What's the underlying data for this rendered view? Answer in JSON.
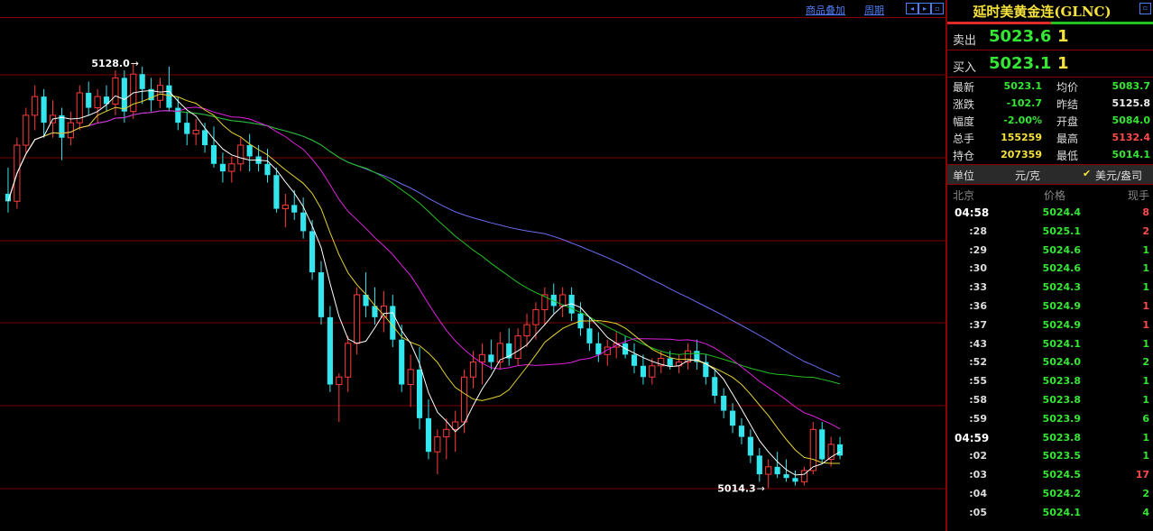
{
  "toolbar": {
    "overlay_label": "商品叠加",
    "period_label": "周期",
    "buttons": [
      "◂",
      "▸",
      "▫"
    ]
  },
  "chart_data": {
    "type": "candlestick",
    "y_range": [
      5005,
      5140
    ],
    "max_label": "5128.0",
    "min_label": "5014.3",
    "colors": {
      "up": "#ff3b3b",
      "down": "#33e6ee",
      "gridline": "#7a0000",
      "ma5": "#ffffff",
      "ma10": "#e6d230",
      "ma20": "#e020e0",
      "ma40": "#22c022",
      "ma60": "#6c6cf0"
    },
    "candles": [
      [
        5093,
        5100,
        5088,
        5091
      ],
      [
        5091,
        5108,
        5089,
        5106
      ],
      [
        5106,
        5116,
        5104,
        5114
      ],
      [
        5114,
        5122,
        5110,
        5119
      ],
      [
        5119,
        5121,
        5108,
        5112
      ],
      [
        5112,
        5118,
        5108,
        5114
      ],
      [
        5114,
        5116,
        5102,
        5108
      ],
      [
        5108,
        5115,
        5106,
        5112
      ],
      [
        5112,
        5122,
        5110,
        5120
      ],
      [
        5120,
        5123,
        5114,
        5116
      ],
      [
        5116,
        5121,
        5112,
        5119
      ],
      [
        5119,
        5122,
        5115,
        5117
      ],
      [
        5117,
        5126,
        5114,
        5124
      ],
      [
        5124,
        5126,
        5112,
        5115
      ],
      [
        5115,
        5128,
        5113,
        5125
      ],
      [
        5125,
        5127,
        5117,
        5121
      ],
      [
        5121,
        5124,
        5115,
        5118
      ],
      [
        5118,
        5124,
        5116,
        5122
      ],
      [
        5122,
        5127,
        5115,
        5116
      ],
      [
        5116,
        5119,
        5110,
        5112
      ],
      [
        5112,
        5115,
        5106,
        5109
      ],
      [
        5109,
        5113,
        5106,
        5110
      ],
      [
        5110,
        5112,
        5104,
        5106
      ],
      [
        5106,
        5111,
        5100,
        5101
      ],
      [
        5101,
        5104,
        5096,
        5099
      ],
      [
        5099,
        5103,
        5096,
        5101
      ],
      [
        5101,
        5108,
        5099,
        5106
      ],
      [
        5106,
        5109,
        5099,
        5103
      ],
      [
        5103,
        5106,
        5099,
        5101
      ],
      [
        5101,
        5105,
        5096,
        5098
      ],
      [
        5098,
        5100,
        5088,
        5089
      ],
      [
        5089,
        5093,
        5084,
        5090
      ],
      [
        5090,
        5094,
        5086,
        5088
      ],
      [
        5088,
        5092,
        5081,
        5083
      ],
      [
        5083,
        5086,
        5070,
        5072
      ],
      [
        5072,
        5075,
        5058,
        5060
      ],
      [
        5060,
        5063,
        5040,
        5042
      ],
      [
        5042,
        5045,
        5032,
        5044
      ],
      [
        5044,
        5055,
        5040,
        5053
      ],
      [
        5053,
        5068,
        5050,
        5066
      ],
      [
        5066,
        5072,
        5060,
        5063
      ],
      [
        5063,
        5068,
        5058,
        5060
      ],
      [
        5060,
        5067,
        5056,
        5063
      ],
      [
        5063,
        5066,
        5052,
        5054
      ],
      [
        5054,
        5058,
        5040,
        5042
      ],
      [
        5042,
        5050,
        5036,
        5046
      ],
      [
        5046,
        5052,
        5030,
        5033
      ],
      [
        5033,
        5038,
        5022,
        5024
      ],
      [
        5024,
        5030,
        5018,
        5028
      ],
      [
        5028,
        5033,
        5022,
        5030
      ],
      [
        5030,
        5035,
        5024,
        5032
      ],
      [
        5032,
        5046,
        5029,
        5044
      ],
      [
        5044,
        5051,
        5041,
        5048
      ],
      [
        5048,
        5053,
        5042,
        5050
      ],
      [
        5050,
        5054,
        5046,
        5048
      ],
      [
        5048,
        5056,
        5046,
        5053
      ],
      [
        5053,
        5057,
        5047,
        5049
      ],
      [
        5049,
        5057,
        5047,
        5055
      ],
      [
        5055,
        5061,
        5052,
        5058
      ],
      [
        5058,
        5064,
        5054,
        5062
      ],
      [
        5062,
        5068,
        5058,
        5066
      ],
      [
        5066,
        5069,
        5061,
        5063
      ],
      [
        5063,
        5068,
        5060,
        5066
      ],
      [
        5066,
        5068,
        5059,
        5061
      ],
      [
        5061,
        5064,
        5055,
        5057
      ],
      [
        5057,
        5060,
        5051,
        5053
      ],
      [
        5053,
        5056,
        5048,
        5050
      ],
      [
        5050,
        5054,
        5047,
        5052
      ],
      [
        5052,
        5056,
        5049,
        5053
      ],
      [
        5053,
        5055,
        5049,
        5050
      ],
      [
        5050,
        5053,
        5045,
        5047
      ],
      [
        5047,
        5050,
        5042,
        5044
      ],
      [
        5044,
        5049,
        5042,
        5047
      ],
      [
        5047,
        5051,
        5045,
        5049
      ],
      [
        5049,
        5051,
        5046,
        5047
      ],
      [
        5047,
        5050,
        5045,
        5048
      ],
      [
        5048,
        5053,
        5046,
        5051
      ],
      [
        5051,
        5054,
        5046,
        5048
      ],
      [
        5048,
        5050,
        5042,
        5044
      ],
      [
        5044,
        5046,
        5037,
        5039
      ],
      [
        5039,
        5041,
        5033,
        5035
      ],
      [
        5035,
        5037,
        5029,
        5031
      ],
      [
        5031,
        5033,
        5026,
        5028
      ],
      [
        5028,
        5030,
        5021,
        5023
      ],
      [
        5023,
        5025,
        5016,
        5018
      ],
      [
        5018,
        5022,
        5014.3,
        5020
      ],
      [
        5020,
        5024,
        5017,
        5018
      ],
      [
        5018,
        5022,
        5016,
        5017
      ],
      [
        5017,
        5019,
        5015,
        5016
      ],
      [
        5016,
        5020,
        5015,
        5019
      ],
      [
        5019,
        5032,
        5018,
        5030
      ],
      [
        5030,
        5032,
        5021,
        5022
      ],
      [
        5022,
        5028,
        5020,
        5026
      ],
      [
        5026,
        5028,
        5022,
        5023
      ]
    ]
  },
  "panel": {
    "title": "延时美黄金连(GLNC)",
    "sell": {
      "label": "卖出",
      "price": "5023.6",
      "volume": "1"
    },
    "buy": {
      "label": "买入",
      "price": "5023.1",
      "volume": "1"
    },
    "stats": [
      {
        "l1": "最新",
        "v1": "5023.1",
        "c1": "green",
        "l2": "均价",
        "v2": "5083.7",
        "c2": "green"
      },
      {
        "l1": "涨跌",
        "v1": "-102.7",
        "c1": "green",
        "l2": "昨结",
        "v2": "5125.8",
        "c2": "white"
      },
      {
        "l1": "幅度",
        "v1": "-2.00%",
        "c1": "green",
        "l2": "开盘",
        "v2": "5084.0",
        "c2": "green"
      },
      {
        "l1": "总手",
        "v1": "155259",
        "c1": "yellow",
        "l2": "最高",
        "v2": "5132.4",
        "c2": "red"
      },
      {
        "l1": "持仓",
        "v1": "207359",
        "c1": "yellow",
        "l2": "最低",
        "v2": "5014.1",
        "c2": "green"
      }
    ],
    "unit": {
      "label": "单位",
      "cny": "元/克",
      "check": "✔",
      "usd": "美元/盎司"
    },
    "tick_header": {
      "time": "北京",
      "price": "价格",
      "volume": "现手"
    },
    "ticks": [
      {
        "time": "04:58",
        "full": true,
        "price": "5024.4",
        "vol": "8",
        "vc": "red"
      },
      {
        "time": ":28",
        "full": false,
        "price": "5025.1",
        "vol": "2",
        "vc": "red"
      },
      {
        "time": ":29",
        "full": false,
        "price": "5024.6",
        "vol": "1",
        "vc": "green"
      },
      {
        "time": ":30",
        "full": false,
        "price": "5024.6",
        "vol": "1",
        "vc": "green"
      },
      {
        "time": ":33",
        "full": false,
        "price": "5024.3",
        "vol": "1",
        "vc": "green"
      },
      {
        "time": ":36",
        "full": false,
        "price": "5024.9",
        "vol": "1",
        "vc": "red"
      },
      {
        "time": ":37",
        "full": false,
        "price": "5024.9",
        "vol": "1",
        "vc": "red"
      },
      {
        "time": ":43",
        "full": false,
        "price": "5024.1",
        "vol": "1",
        "vc": "green"
      },
      {
        "time": ":52",
        "full": false,
        "price": "5024.0",
        "vol": "2",
        "vc": "green"
      },
      {
        "time": ":55",
        "full": false,
        "price": "5023.8",
        "vol": "1",
        "vc": "green"
      },
      {
        "time": ":58",
        "full": false,
        "price": "5023.8",
        "vol": "1",
        "vc": "green"
      },
      {
        "time": ":59",
        "full": false,
        "price": "5023.9",
        "vol": "6",
        "vc": "green"
      },
      {
        "time": "04:59",
        "full": true,
        "price": "5023.8",
        "vol": "1",
        "vc": "green"
      },
      {
        "time": ":02",
        "full": false,
        "price": "5023.5",
        "vol": "1",
        "vc": "green"
      },
      {
        "time": ":03",
        "full": false,
        "price": "5024.5",
        "vol": "17",
        "vc": "red"
      },
      {
        "time": ":04",
        "full": false,
        "price": "5024.2",
        "vol": "2",
        "vc": "green"
      },
      {
        "time": ":05",
        "full": false,
        "price": "5024.1",
        "vol": "4",
        "vc": "green"
      }
    ]
  }
}
